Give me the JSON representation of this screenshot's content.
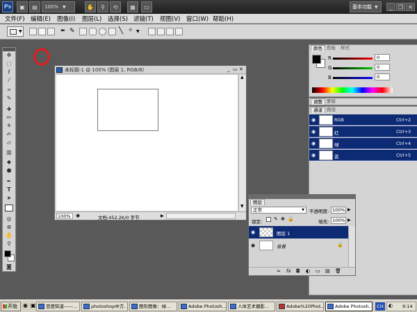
{
  "app": {
    "icon_label": "Ps",
    "zoom": "100%",
    "workspace": "基本功能"
  },
  "menu": {
    "items": [
      "文件(F)",
      "编辑(E)",
      "图像(I)",
      "图层(L)",
      "选择(S)",
      "滤镜(T)",
      "视图(V)",
      "窗口(W)",
      "帮助(H)"
    ]
  },
  "options": {
    "highlight_color": "#e8181b"
  },
  "document": {
    "title": "未标题-1 @ 100% (图层 1, RGB/8)",
    "zoom": "100%",
    "doc_info": "文档:452.2K/0 字节"
  },
  "color_panel": {
    "tabs": [
      "颜色",
      "色板",
      "样式"
    ],
    "channels": [
      {
        "label": "R",
        "value": "0"
      },
      {
        "label": "G",
        "value": "0"
      },
      {
        "label": "B",
        "value": "0"
      }
    ]
  },
  "adjust_panel": {
    "tabs": [
      "调整",
      "蒙版"
    ]
  },
  "channels_panel": {
    "tabs": [
      "通道",
      "路径"
    ],
    "rows": [
      {
        "name": "RGB",
        "shortcut": "Ctrl+2"
      },
      {
        "name": "红",
        "shortcut": "Ctrl+3"
      },
      {
        "name": "绿",
        "shortcut": "Ctrl+4"
      },
      {
        "name": "蓝",
        "shortcut": "Ctrl+5"
      }
    ]
  },
  "layers_panel": {
    "tab": "图层",
    "blend_mode": "正常",
    "opacity_label": "不透明度:",
    "opacity": "100%",
    "lock_label": "锁定:",
    "fill_label": "填充:",
    "fill": "100%",
    "layers": [
      {
        "name": "图层 1"
      },
      {
        "name": "背景"
      }
    ]
  },
  "taskbar": {
    "start": "开始",
    "tasks": [
      "百度知道——...",
      "photoshop中方...",
      "图形图像：绿...",
      "Adobe Photosh...",
      "人体艺术摄影...",
      "Adobe%20Phot...",
      "Adobe Photosh..."
    ],
    "ime": "CH",
    "time": "9:14"
  }
}
